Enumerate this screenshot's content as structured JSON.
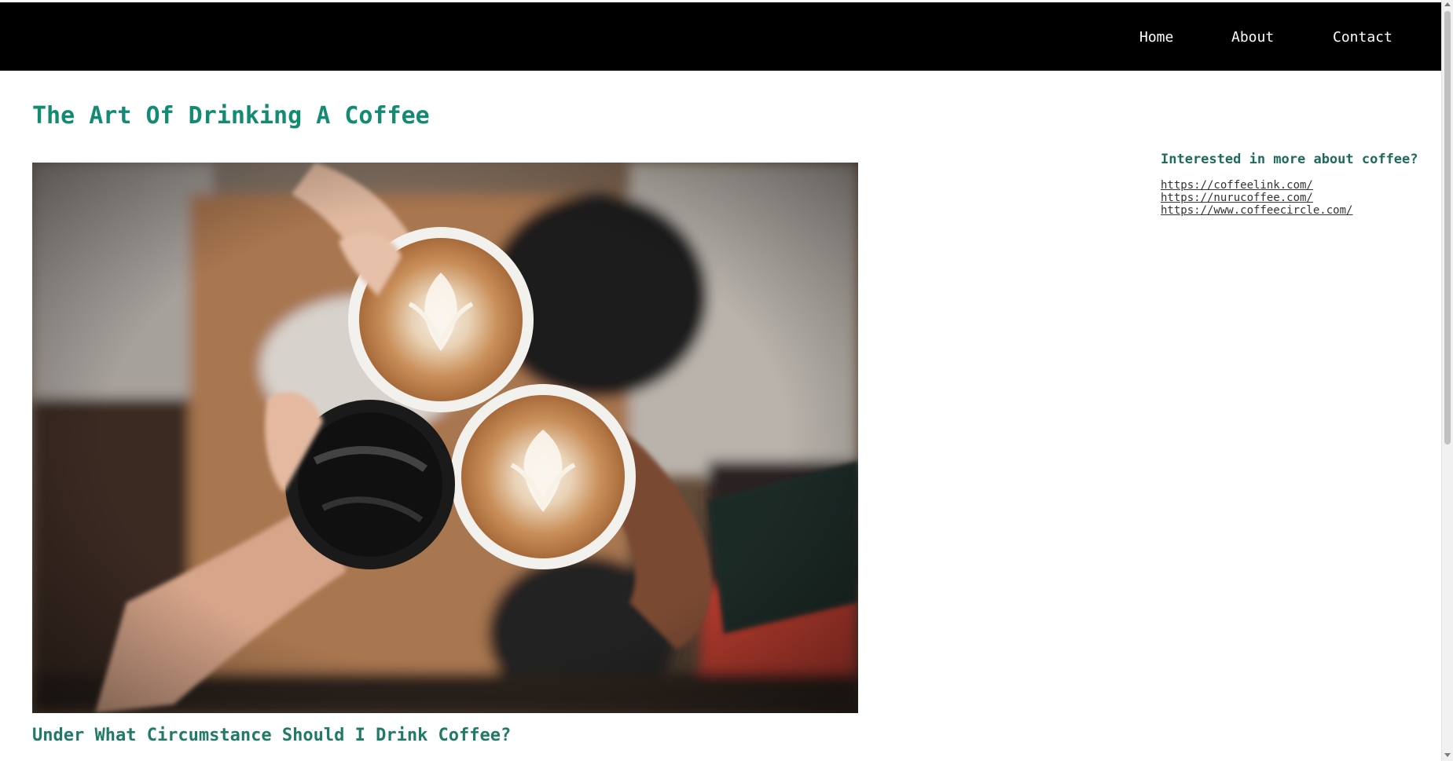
{
  "nav": {
    "items": [
      {
        "label": "Home"
      },
      {
        "label": "About"
      },
      {
        "label": "Contact"
      }
    ]
  },
  "main": {
    "title": "The Art Of Drinking A Coffee",
    "hero_image": {
      "subject": "hands toasting coffee cups with latte art"
    },
    "section_heading": "Under What Circumstance Should I Drink Coffee?"
  },
  "sidebar": {
    "heading": "Interested in more about coffee?",
    "links": [
      {
        "label": "https://coffeelink.com/"
      },
      {
        "label": "https://nurucoffee.com/"
      },
      {
        "label": "https://www.coffeecircle.com/"
      }
    ]
  },
  "colors": {
    "navbar_bg": "#000000",
    "nav_text": "#ffffff",
    "title": "#138a72",
    "heading": "#1f7a66",
    "sidebar_heading": "#1f6b5b",
    "link": "#333333"
  }
}
